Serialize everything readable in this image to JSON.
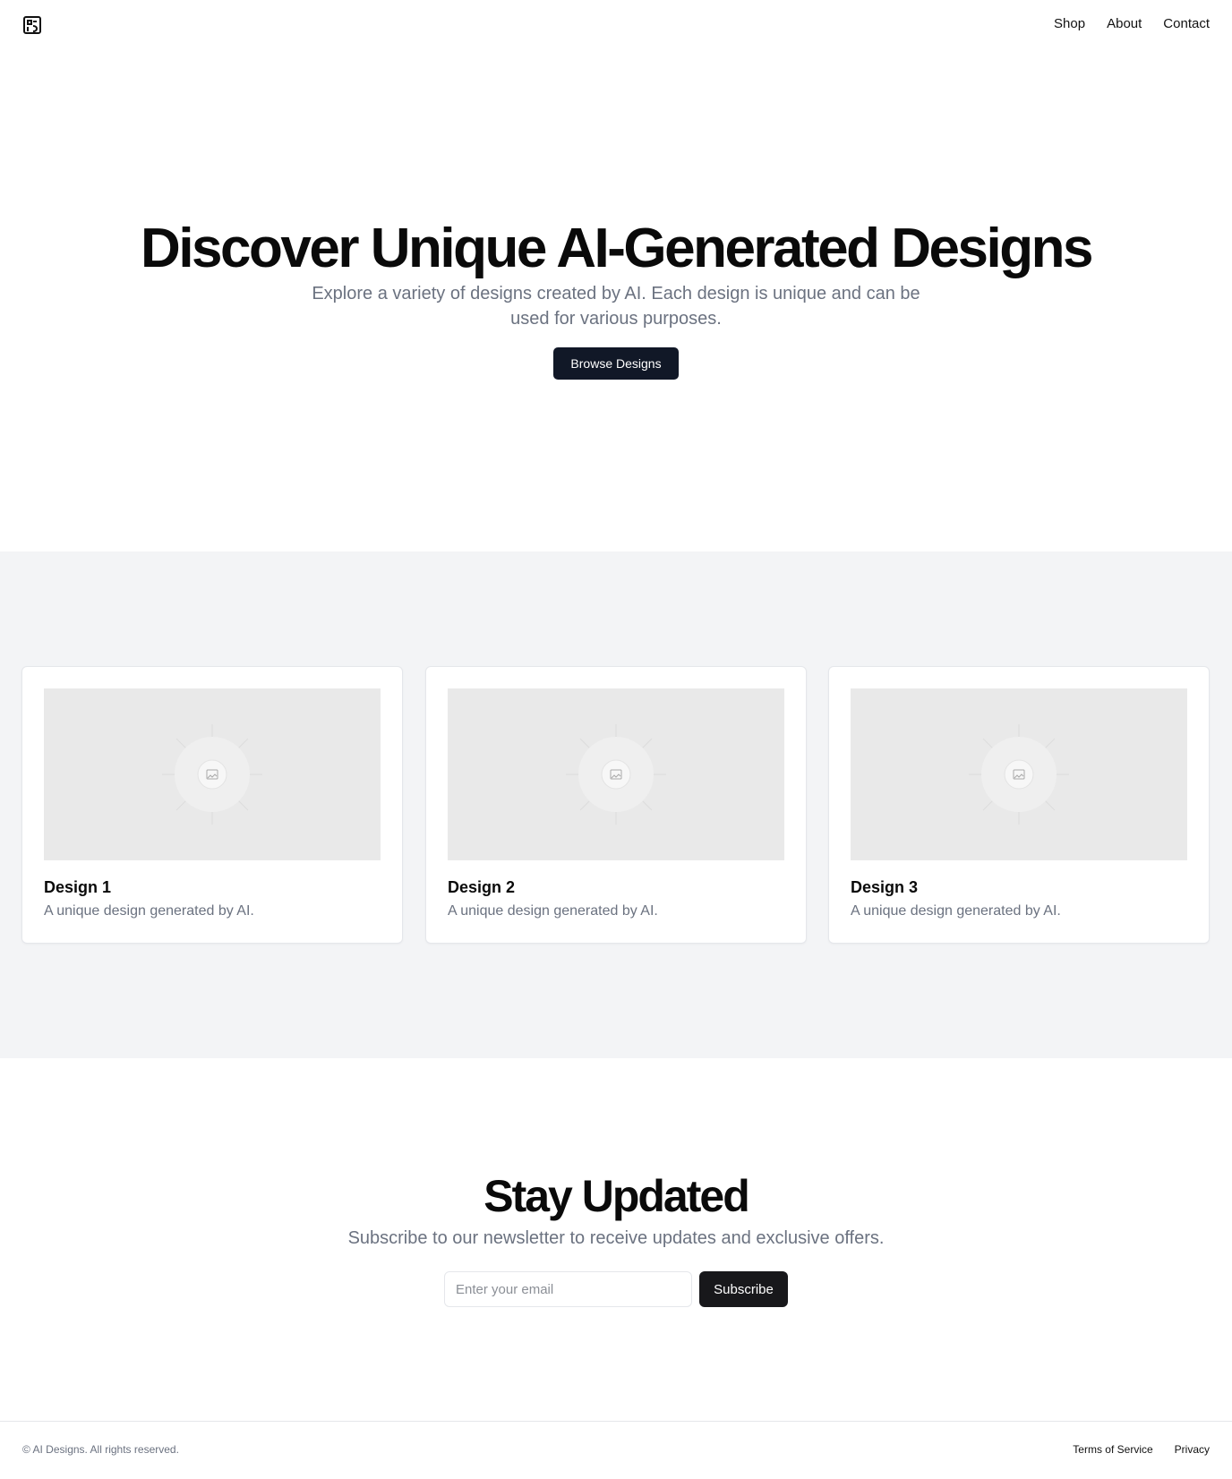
{
  "header": {
    "logo_icon": "brand-logo-icon",
    "nav": [
      {
        "label": "Shop"
      },
      {
        "label": "About"
      },
      {
        "label": "Contact"
      }
    ]
  },
  "hero": {
    "title": "Discover Unique AI-Generated Designs",
    "subtitle": "Explore a variety of designs created by AI. Each design is unique and can be used for various purposes.",
    "cta_label": "Browse Designs"
  },
  "gallery": {
    "cards": [
      {
        "title": "Design 1",
        "description": "A unique design generated by AI.",
        "image_icon": "image-placeholder-icon"
      },
      {
        "title": "Design 2",
        "description": "A unique design generated by AI.",
        "image_icon": "image-placeholder-icon"
      },
      {
        "title": "Design 3",
        "description": "A unique design generated by AI.",
        "image_icon": "image-placeholder-icon"
      }
    ]
  },
  "newsletter": {
    "title": "Stay Updated",
    "subtitle": "Subscribe to our newsletter to receive updates and exclusive offers.",
    "email_placeholder": "Enter your email",
    "email_value": "",
    "button_label": "Subscribe"
  },
  "footer": {
    "copyright": "© AI Designs. All rights reserved.",
    "links": [
      {
        "label": "Terms of Service"
      },
      {
        "label": "Privacy"
      }
    ]
  },
  "colors": {
    "primary_button": "#111827",
    "subscribe_button": "#18181b",
    "muted_text": "#6b7280",
    "section_background": "#f3f4f6"
  }
}
